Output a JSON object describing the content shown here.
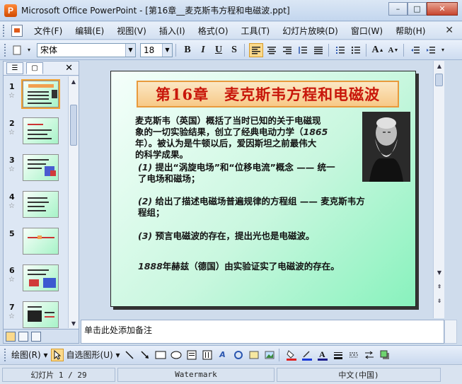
{
  "window": {
    "title": "Microsoft Office PowerPoint - [第16章__麦克斯韦方程和电磁波.ppt]",
    "app_icon_letter": "P",
    "minimize": "–",
    "restore": "□",
    "close": "✕"
  },
  "menu": {
    "items": [
      "文件(F)",
      "编辑(E)",
      "视图(V)",
      "插入(I)",
      "格式(O)",
      "工具(T)",
      "幻灯片放映(D)",
      "窗口(W)",
      "帮助(H)"
    ],
    "close": "✕"
  },
  "toolbar": {
    "font_name": "宋体",
    "font_size": "18",
    "bold": "B",
    "italic": "I",
    "underline": "U",
    "shadow": "S"
  },
  "pane": {
    "tab_outline": "☰",
    "tab_slides": "▢",
    "close": "✕",
    "thumbnails": [
      {
        "num": "1"
      },
      {
        "num": "2"
      },
      {
        "num": "3"
      },
      {
        "num": "4"
      },
      {
        "num": "5"
      },
      {
        "num": "6"
      },
      {
        "num": "7"
      }
    ]
  },
  "slide": {
    "title": "第16章　麦克斯韦方程和电磁波",
    "intro_1": "麦克斯韦（英国）概括了当时已知的关于电磁现",
    "intro_2_a": "象的一切实验结果，创立了经典电动力学（",
    "intro_2_year": "1865",
    "intro_3": "年）。被认为是牛顿以后，爱因斯坦之前最伟大",
    "intro_4": "的科学成果。",
    "item1_num": "(1)",
    "item1_a": "提出“涡旋电场”和“位移电流”概念 —— 统一",
    "item1_b": "了电场和磁场；",
    "item2_num": "(2)",
    "item2_a": "给出了描述电磁场普遍规律的方程组 —— 麦克斯韦方",
    "item2_b": "程组；",
    "item3_num": "(3)",
    "item3_a": "预言电磁波的存在，提出光也是电磁波。",
    "last_year": "1888",
    "last_text": "年赫兹（德国）由实验证实了电磁波的存在。"
  },
  "notes": {
    "placeholder": "单击此处添加备注"
  },
  "drawbar": {
    "draw": "绘图(R) ▾",
    "autoshapes": "自选图形(U) ▾"
  },
  "status": {
    "slide": "幻灯片 1 / 29",
    "design": "Watermark",
    "language": "中文(中国)"
  }
}
